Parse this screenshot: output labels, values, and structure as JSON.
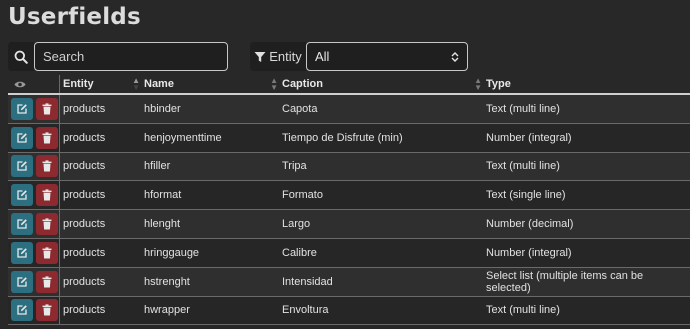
{
  "page": {
    "title": "Userfields"
  },
  "search": {
    "placeholder": "Search",
    "value": ""
  },
  "entity_filter": {
    "label": "Entity",
    "selected": "All"
  },
  "table": {
    "columns": {
      "entity": "Entity",
      "name": "Name",
      "caption": "Caption",
      "type": "Type"
    },
    "rows": [
      {
        "entity": "products",
        "name": "hbinder",
        "caption": "Capota",
        "type": "Text (multi line)"
      },
      {
        "entity": "products",
        "name": "henjoymenttime",
        "caption": "Tiempo de Disfrute (min)",
        "type": "Number (integral)"
      },
      {
        "entity": "products",
        "name": "hfiller",
        "caption": "Tripa",
        "type": "Text (multi line)"
      },
      {
        "entity": "products",
        "name": "hformat",
        "caption": "Formato",
        "type": "Text (single line)"
      },
      {
        "entity": "products",
        "name": "hlenght",
        "caption": "Largo",
        "type": "Number (decimal)"
      },
      {
        "entity": "products",
        "name": "hringgauge",
        "caption": "Calibre",
        "type": "Number (integral)"
      },
      {
        "entity": "products",
        "name": "hstrenght",
        "caption": "Intensidad",
        "type": "Select list (multiple items can be selected)"
      },
      {
        "entity": "products",
        "name": "hwrapper",
        "caption": "Envoltura",
        "type": "Text (multi line)"
      }
    ]
  },
  "icons": {
    "search": "search-icon",
    "filter": "filter-icon",
    "select_arrows": "select-arrows-icon",
    "visibility": "eye-icon",
    "edit": "edit-icon",
    "delete": "trash-icon"
  },
  "colors": {
    "background": "#282828",
    "edit_button": "#2c6f80",
    "delete_button": "#8c2a2f"
  }
}
